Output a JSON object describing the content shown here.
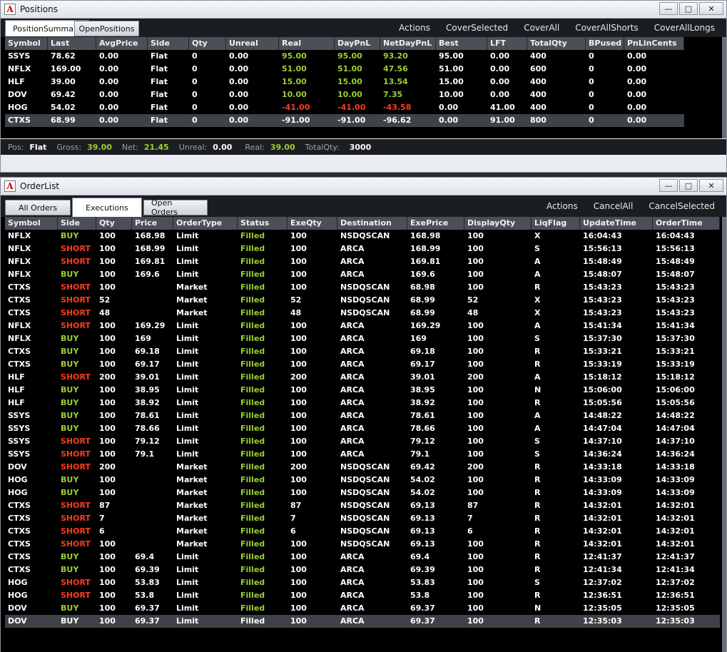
{
  "positions": {
    "title": "Positions",
    "tabs": [
      "PositionSummary",
      "OpenPositions"
    ],
    "actions": [
      "Actions",
      "CoverSelected",
      "CoverAll",
      "CoverAllShorts",
      "CoverAllLongs"
    ],
    "columns": [
      "Symbol",
      "Last",
      "AvgPrice",
      "Side",
      "Qty",
      "Unreal",
      "Real",
      "DayPnL",
      "NetDayPnL",
      "Best",
      "LFT",
      "TotalQty",
      "BPused",
      "PnLinCents"
    ],
    "rows": [
      [
        "SSYS",
        "78.62",
        "0.00",
        "Flat",
        "0",
        "0.00",
        "95.00",
        "95.00",
        "93.20",
        "95.00",
        "0.00",
        "400",
        "0",
        "0.00"
      ],
      [
        "NFLX",
        "169.00",
        "0.00",
        "Flat",
        "0",
        "0.00",
        "51.00",
        "51.00",
        "47.56",
        "51.00",
        "0.00",
        "600",
        "0",
        "0.00"
      ],
      [
        "HLF",
        "39.00",
        "0.00",
        "Flat",
        "0",
        "0.00",
        "15.00",
        "15.00",
        "13.54",
        "15.00",
        "0.00",
        "400",
        "0",
        "0.00"
      ],
      [
        "DOV",
        "69.42",
        "0.00",
        "Flat",
        "0",
        "0.00",
        "10.00",
        "10.00",
        "7.35",
        "10.00",
        "0.00",
        "400",
        "0",
        "0.00"
      ],
      [
        "HOG",
        "54.02",
        "0.00",
        "Flat",
        "0",
        "0.00",
        "-41.00",
        "-41.00",
        "-43.58",
        "0.00",
        "41.00",
        "400",
        "0",
        "0.00"
      ],
      [
        "CTXS",
        "68.99",
        "0.00",
        "Flat",
        "0",
        "0.00",
        "-91.00",
        "-91.00",
        "-96.62",
        "0.00",
        "91.00",
        "800",
        "0",
        "0.00"
      ]
    ],
    "status": {
      "pos_label": "Pos:",
      "pos": "Flat",
      "gross_label": "Gross:",
      "gross": "39.00",
      "net_label": "Net:",
      "net": "21.45",
      "unreal_label": "Unreal:",
      "unreal": "0.00",
      "real_label": "Real:",
      "real": "39.00",
      "totalqty_label": "TotalQty:",
      "totalqty": "3000"
    }
  },
  "orders": {
    "title": "OrderList",
    "tabs": [
      "All Orders",
      "Executions",
      "Open Orders"
    ],
    "actions": [
      "Actions",
      "CancelAll",
      "CancelSelected"
    ],
    "columns": [
      "Symbol",
      "Side",
      "Qty",
      "Price",
      "OrderType",
      "Status",
      "ExeQty",
      "Destination",
      "ExePrice",
      "DisplayQty",
      "LiqFlag",
      "UpdateTime",
      "OrderTime"
    ],
    "rows": [
      [
        "NFLX",
        "BUY",
        "100",
        "168.98",
        "Limit",
        "Filled",
        "100",
        "NSDQSCAN",
        "168.98",
        "100",
        "X",
        "16:04:43",
        "16:04:43"
      ],
      [
        "NFLX",
        "SHORT",
        "100",
        "168.99",
        "Limit",
        "Filled",
        "100",
        "ARCA",
        "168.99",
        "100",
        "S",
        "15:56:13",
        "15:56:13"
      ],
      [
        "NFLX",
        "SHORT",
        "100",
        "169.81",
        "Limit",
        "Filled",
        "100",
        "ARCA",
        "169.81",
        "100",
        "A",
        "15:48:49",
        "15:48:49"
      ],
      [
        "NFLX",
        "BUY",
        "100",
        "169.6",
        "Limit",
        "Filled",
        "100",
        "ARCA",
        "169.6",
        "100",
        "A",
        "15:48:07",
        "15:48:07"
      ],
      [
        "CTXS",
        "SHORT",
        "100",
        "",
        "Market",
        "Filled",
        "100",
        "NSDQSCAN",
        "68.98",
        "100",
        "R",
        "15:43:23",
        "15:43:23"
      ],
      [
        "CTXS",
        "SHORT",
        "52",
        "",
        "Market",
        "Filled",
        "52",
        "NSDQSCAN",
        "68.99",
        "52",
        "X",
        "15:43:23",
        "15:43:23"
      ],
      [
        "CTXS",
        "SHORT",
        "48",
        "",
        "Market",
        "Filled",
        "48",
        "NSDQSCAN",
        "68.99",
        "48",
        "X",
        "15:43:23",
        "15:43:23"
      ],
      [
        "NFLX",
        "SHORT",
        "100",
        "169.29",
        "Limit",
        "Filled",
        "100",
        "ARCA",
        "169.29",
        "100",
        "A",
        "15:41:34",
        "15:41:34"
      ],
      [
        "NFLX",
        "BUY",
        "100",
        "169",
        "Limit",
        "Filled",
        "100",
        "ARCA",
        "169",
        "100",
        "S",
        "15:37:30",
        "15:37:30"
      ],
      [
        "CTXS",
        "BUY",
        "100",
        "69.18",
        "Limit",
        "Filled",
        "100",
        "ARCA",
        "69.18",
        "100",
        "R",
        "15:33:21",
        "15:33:21"
      ],
      [
        "CTXS",
        "BUY",
        "100",
        "69.17",
        "Limit",
        "Filled",
        "100",
        "ARCA",
        "69.17",
        "100",
        "R",
        "15:33:19",
        "15:33:19"
      ],
      [
        "HLF",
        "SHORT",
        "200",
        "39.01",
        "Limit",
        "Filled",
        "200",
        "ARCA",
        "39.01",
        "200",
        "A",
        "15:18:12",
        "15:18:12"
      ],
      [
        "HLF",
        "BUY",
        "100",
        "38.95",
        "Limit",
        "Filled",
        "100",
        "ARCA",
        "38.95",
        "100",
        "N",
        "15:06:00",
        "15:06:00"
      ],
      [
        "HLF",
        "BUY",
        "100",
        "38.92",
        "Limit",
        "Filled",
        "100",
        "ARCA",
        "38.92",
        "100",
        "R",
        "15:05:56",
        "15:05:56"
      ],
      [
        "SSYS",
        "BUY",
        "100",
        "78.61",
        "Limit",
        "Filled",
        "100",
        "ARCA",
        "78.61",
        "100",
        "A",
        "14:48:22",
        "14:48:22"
      ],
      [
        "SSYS",
        "BUY",
        "100",
        "78.66",
        "Limit",
        "Filled",
        "100",
        "ARCA",
        "78.66",
        "100",
        "A",
        "14:47:04",
        "14:47:04"
      ],
      [
        "SSYS",
        "SHORT",
        "100",
        "79.12",
        "Limit",
        "Filled",
        "100",
        "ARCA",
        "79.12",
        "100",
        "S",
        "14:37:10",
        "14:37:10"
      ],
      [
        "SSYS",
        "SHORT",
        "100",
        "79.1",
        "Limit",
        "Filled",
        "100",
        "ARCA",
        "79.1",
        "100",
        "S",
        "14:36:24",
        "14:36:24"
      ],
      [
        "DOV",
        "SHORT",
        "200",
        "",
        "Market",
        "Filled",
        "200",
        "NSDQSCAN",
        "69.42",
        "200",
        "R",
        "14:33:18",
        "14:33:18"
      ],
      [
        "HOG",
        "BUY",
        "100",
        "",
        "Market",
        "Filled",
        "100",
        "NSDQSCAN",
        "54.02",
        "100",
        "R",
        "14:33:09",
        "14:33:09"
      ],
      [
        "HOG",
        "BUY",
        "100",
        "",
        "Market",
        "Filled",
        "100",
        "NSDQSCAN",
        "54.02",
        "100",
        "R",
        "14:33:09",
        "14:33:09"
      ],
      [
        "CTXS",
        "SHORT",
        "87",
        "",
        "Market",
        "Filled",
        "87",
        "NSDQSCAN",
        "69.13",
        "87",
        "R",
        "14:32:01",
        "14:32:01"
      ],
      [
        "CTXS",
        "SHORT",
        "7",
        "",
        "Market",
        "Filled",
        "7",
        "NSDQSCAN",
        "69.13",
        "7",
        "R",
        "14:32:01",
        "14:32:01"
      ],
      [
        "CTXS",
        "SHORT",
        "6",
        "",
        "Market",
        "Filled",
        "6",
        "NSDQSCAN",
        "69.13",
        "6",
        "R",
        "14:32:01",
        "14:32:01"
      ],
      [
        "CTXS",
        "SHORT",
        "100",
        "",
        "Market",
        "Filled",
        "100",
        "NSDQSCAN",
        "69.13",
        "100",
        "R",
        "14:32:01",
        "14:32:01"
      ],
      [
        "CTXS",
        "BUY",
        "100",
        "69.4",
        "Limit",
        "Filled",
        "100",
        "ARCA",
        "69.4",
        "100",
        "R",
        "12:41:37",
        "12:41:37"
      ],
      [
        "CTXS",
        "BUY",
        "100",
        "69.39",
        "Limit",
        "Filled",
        "100",
        "ARCA",
        "69.39",
        "100",
        "R",
        "12:41:34",
        "12:41:34"
      ],
      [
        "HOG",
        "SHORT",
        "100",
        "53.83",
        "Limit",
        "Filled",
        "100",
        "ARCA",
        "53.83",
        "100",
        "S",
        "12:37:02",
        "12:37:02"
      ],
      [
        "HOG",
        "SHORT",
        "100",
        "53.8",
        "Limit",
        "Filled",
        "100",
        "ARCA",
        "53.8",
        "100",
        "R",
        "12:36:51",
        "12:36:51"
      ],
      [
        "DOV",
        "BUY",
        "100",
        "69.37",
        "Limit",
        "Filled",
        "100",
        "ARCA",
        "69.37",
        "100",
        "N",
        "12:35:05",
        "12:35:05"
      ],
      [
        "DOV",
        "BUY",
        "100",
        "69.37",
        "Limit",
        "Filled",
        "100",
        "ARCA",
        "69.37",
        "100",
        "R",
        "12:35:03",
        "12:35:03"
      ]
    ]
  },
  "colors": {
    "positive": "#9ad032",
    "negative": "#ff3a1e",
    "header": "#4b5058",
    "grid_bg": "#000000"
  },
  "icons": {
    "app": "A",
    "minimize": "minimize-icon",
    "maximize": "maximize-icon",
    "close": "close-icon"
  }
}
